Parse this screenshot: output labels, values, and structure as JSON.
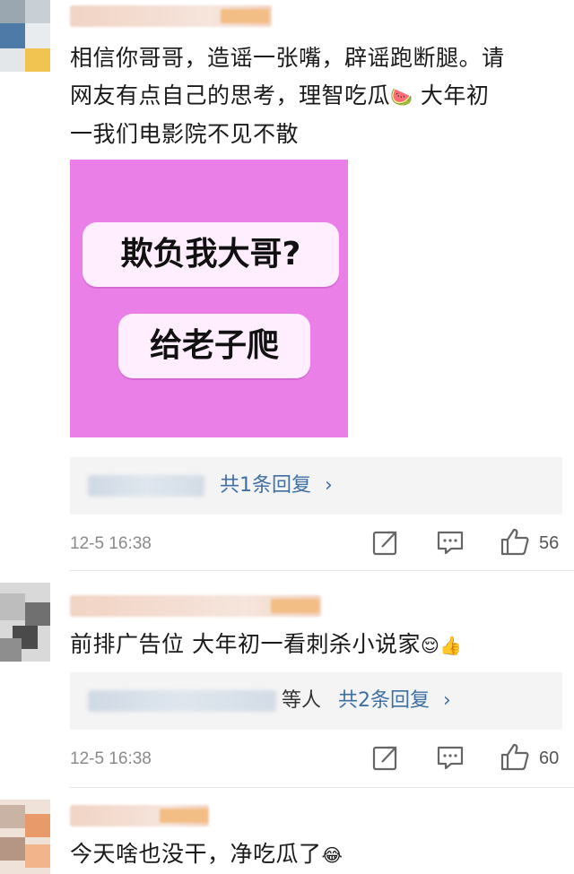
{
  "comments": [
    {
      "text_lines": [
        "相信你哥哥，造谣一张嘴，辟谣跑断腿。请",
        "网友有点自己的思考，理智吃瓜",
        "一我们电影院不见不散"
      ],
      "inline_emoji": "🍉",
      "inline_after": " 大年初",
      "image": {
        "bubble1": "欺负我大哥?",
        "bubble2": "给老子爬"
      },
      "reply_link": "共1条回复",
      "reply_suffix": "",
      "timestamp": "12-5 16:38",
      "likes": "56"
    },
    {
      "text": "前排广告位 大年初一看刺杀小说家",
      "emojis": "😌👍",
      "reply_prefix": "等人",
      "reply_link": "共2条回复",
      "timestamp": "12-5 16:38",
      "likes": "60"
    },
    {
      "text": "今天啥也没干，净吃瓜了",
      "emoji": "😂"
    }
  ],
  "icons": {
    "share": "share-icon",
    "comment": "comment-icon",
    "like": "like-icon",
    "chevron": "chevron-right-icon"
  }
}
